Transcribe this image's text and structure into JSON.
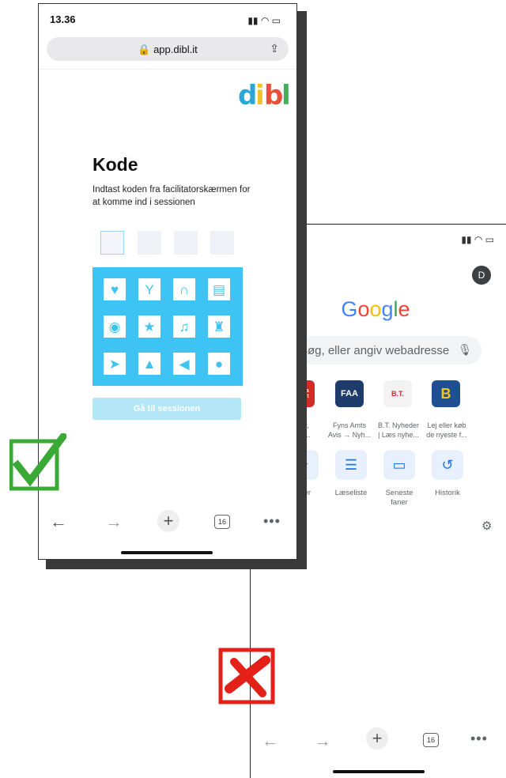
{
  "back_phone": {
    "avatar_letter": "D",
    "google_letters": [
      "G",
      "o",
      "o",
      "g",
      "l",
      "e"
    ],
    "search_placeholder": "Søg, eller angiv webadresse",
    "tiles": [
      {
        "name": "ekstra-bladet",
        "text": "Ekstra Bladet",
        "label": "yheder,\nrt og u...",
        "bg": "#d32a2a",
        "fg": "#ffffff"
      },
      {
        "name": "fyns-amts-avis",
        "text": "FAA",
        "label": "Fyns Amts\nAvis → Nyh...",
        "bg": "#1d3b6b",
        "fg": "#ffffff"
      },
      {
        "name": "bt-nyheder",
        "text": "B.T.",
        "label": "B.T. Nyheder\n| Læs nyhe...",
        "bg": "#f3f3f3",
        "fg": "#d32a2a"
      },
      {
        "name": "lej-eller-kob",
        "text": "B",
        "label": "Lej eller køb\nde nyeste f...",
        "bg": "#1d4f91",
        "fg": "#f5c51b"
      }
    ],
    "shortcuts": [
      {
        "name": "bogmaerker",
        "glyph": "★",
        "label": "gmærker"
      },
      {
        "name": "laeseliste",
        "glyph": "☰",
        "label": "Læseliste"
      },
      {
        "name": "seneste-faner",
        "glyph": "▭",
        "label": "Seneste\nfaner"
      },
      {
        "name": "historik",
        "glyph": "↺",
        "label": "Historik"
      }
    ],
    "partial_text": "er",
    "tab_count": "16"
  },
  "front_phone": {
    "time": "13.36",
    "url": "app.dibl.it",
    "logo_letters": [
      {
        "ch": "d",
        "color": "#2aa7d6"
      },
      {
        "ch": "i",
        "color": "#f2c12e"
      },
      {
        "ch": "b",
        "color": "#e8503a"
      },
      {
        "ch": "l",
        "color": "#3fb15c"
      }
    ],
    "title": "Kode",
    "instruction": "Indtast koden fra facilitatorskærmen for at komme ind i sessionen",
    "icons": [
      "heart",
      "cocktail",
      "headphones",
      "briefcase",
      "eye",
      "star",
      "music",
      "castle",
      "paper-plane",
      "tree",
      "megaphone",
      "drop"
    ],
    "go_button": "Gå til sessionen",
    "tab_count": "16"
  },
  "colors": {
    "accent_blue": "#3ec4f4",
    "check_green": "#3aa935",
    "cross_red": "#e32119"
  }
}
